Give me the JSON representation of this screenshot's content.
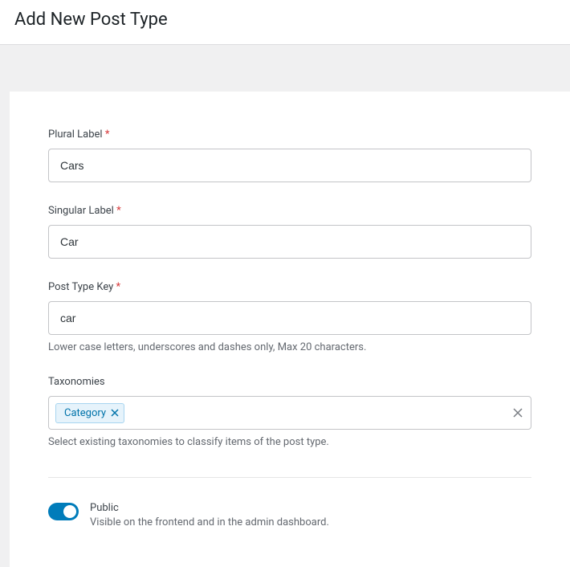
{
  "page": {
    "title": "Add New Post Type"
  },
  "fields": {
    "plural_label": {
      "label": "Plural Label",
      "required_marker": "*",
      "value": "Cars"
    },
    "singular_label": {
      "label": "Singular Label",
      "required_marker": "*",
      "value": "Car"
    },
    "post_type_key": {
      "label": "Post Type Key",
      "required_marker": "*",
      "value": "car",
      "help": "Lower case letters, underscores and dashes only, Max 20 characters."
    },
    "taxonomies": {
      "label": "Taxonomies",
      "selected": [
        {
          "label": "Category"
        }
      ],
      "help": "Select existing taxonomies to classify items of the post type."
    },
    "public": {
      "label": "Public",
      "description": "Visible on the frontend and in the admin dashboard.",
      "value": true
    }
  }
}
